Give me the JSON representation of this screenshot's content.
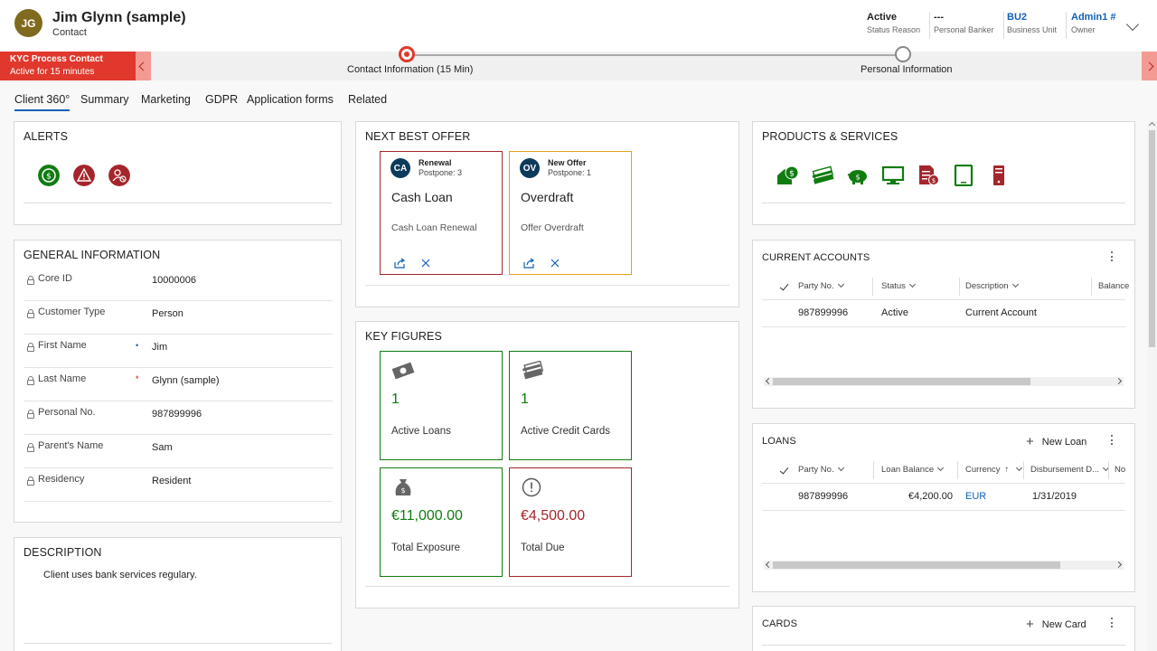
{
  "record": {
    "initials": "JG",
    "name": "Jim Glynn (sample)",
    "type": "Contact"
  },
  "header_fields": [
    {
      "value": "Active",
      "label": "Status Reason"
    },
    {
      "value": "---",
      "label": "Personal Banker"
    },
    {
      "value": "BU2",
      "label": "Business Unit"
    },
    {
      "value": "Admin1 #",
      "label": "Owner"
    }
  ],
  "process": {
    "name": "KYC Process Contact",
    "duration": "Active for 15 minutes",
    "stages": [
      {
        "label": "Contact Information  (15 Min)",
        "state": "active"
      },
      {
        "label": "Personal Information",
        "state": "idle"
      }
    ]
  },
  "tabs": [
    "Client 360°",
    "Summary",
    "Marketing",
    "GDPR",
    "Application forms",
    "Related"
  ],
  "alerts": {
    "title": "ALERTS",
    "icons": [
      "dollar-alert-icon",
      "warning-alert-icon",
      "blocked-user-alert-icon"
    ],
    "colors": [
      "#107c10",
      "#a4262c",
      "#a4262c"
    ]
  },
  "general_info": {
    "title": "GENERAL INFORMATION",
    "fields": [
      {
        "label": "Core ID",
        "value": "10000006",
        "required": ""
      },
      {
        "label": "Customer Type",
        "value": "Person",
        "required": ""
      },
      {
        "label": "First Name",
        "value": "Jim",
        "required": "•"
      },
      {
        "label": "Last Name",
        "value": "Glynn (sample)",
        "required": "*"
      },
      {
        "label": "Personal No.",
        "value": "987899996",
        "required": ""
      },
      {
        "label": "Parent's Name",
        "value": "Sam",
        "required": ""
      },
      {
        "label": "Residency",
        "value": "Resident",
        "required": ""
      }
    ]
  },
  "description": {
    "title": "DESCRIPTION",
    "text": "Client uses bank services regulary."
  },
  "next_best_offer": {
    "title": "NEXT BEST OFFER",
    "offers": [
      {
        "initials": "CA",
        "type": "Renewal",
        "postpone": "Postpone: 3",
        "name": "Cash Loan",
        "desc": "Cash Loan Renewal",
        "border": "#a4262c"
      },
      {
        "initials": "OV",
        "type": "New Offer",
        "postpone": "Postpone: 1",
        "name": "Overdraft",
        "desc": "Offer Overdraft",
        "border": "#e3a21a"
      }
    ]
  },
  "key_figures": {
    "title": "KEY FIGURES",
    "cards": [
      {
        "icon": "money-bill-icon",
        "value": "1",
        "label": "Active Loans",
        "color": "#107c10"
      },
      {
        "icon": "credit-cards-icon",
        "value": "1",
        "label": "Active Credit Cards",
        "color": "#107c10"
      },
      {
        "icon": "money-bag-icon",
        "value": "€11,000.00",
        "label": "Total Exposure",
        "color": "#107c10"
      },
      {
        "icon": "exclamation-circle-icon",
        "value": "€4,500.00",
        "label": "Total Due",
        "color": "#a4262c"
      }
    ]
  },
  "products": {
    "title": "PRODUCTS & SERVICES",
    "icons": [
      "house-loan-icon",
      "cards-icon",
      "piggy-bank-icon",
      "online-banking-icon",
      "statement-icon",
      "tablet-icon",
      "mobile-icon"
    ],
    "colors": [
      "#107c10",
      "#107c10",
      "#107c10",
      "#107c10",
      "#a4262c",
      "#107c10",
      "#a4262c"
    ]
  },
  "current_accounts": {
    "title": "CURRENT ACCOUNTS",
    "columns": [
      "Party No.",
      "Status",
      "Description",
      "Balance"
    ],
    "rows": [
      [
        "987899996",
        "Active",
        "Current Account"
      ]
    ]
  },
  "loans": {
    "title": "LOANS",
    "add_label": "New Loan",
    "columns": [
      "Party No.",
      "Loan Balance",
      "Currency",
      "Disbursement D...",
      "No"
    ],
    "rows": [
      [
        "987899996",
        "€4,200.00",
        "EUR",
        "1/31/2019"
      ]
    ]
  },
  "cards": {
    "title": "CARDS",
    "add_label": "New Card"
  }
}
